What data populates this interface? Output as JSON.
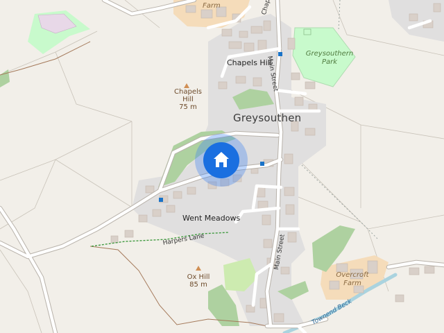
{
  "labels": {
    "village": "Greysouthen",
    "chapels_hill_street": "Chapels Hill",
    "went_meadows": "Went Meadows",
    "park_line1": "Greysouthern",
    "park_line2": "Park",
    "farm_top": "Farm",
    "overcroft_line1": "Overcroft",
    "overcroft_line2": "Farm",
    "chapel_terrace": "Chapel Terrace",
    "main_street_north": "Main Street",
    "main_street_south": "Main Street",
    "harpers_lane": "Harpers Lane",
    "townend_beck": "Townend Beck"
  },
  "peaks": [
    {
      "name_line1": "Chapels",
      "name_line2": "Hill",
      "elevation": "75 m"
    },
    {
      "name_line1": "Ox Hill",
      "name_line2": "",
      "elevation": "85 m"
    }
  ],
  "marker": {
    "icon": "home-icon",
    "accent": "#1a6fe0",
    "halo": "#3f84f0"
  },
  "colors": {
    "background": "#f2efe9",
    "residential": "#e0dfdf",
    "park": "#c8facc",
    "wood": "#aed1a0",
    "farmyard": "#f5dcba",
    "building": "#d9d0c9",
    "water": "#aad3df",
    "road": "#ffffff"
  }
}
